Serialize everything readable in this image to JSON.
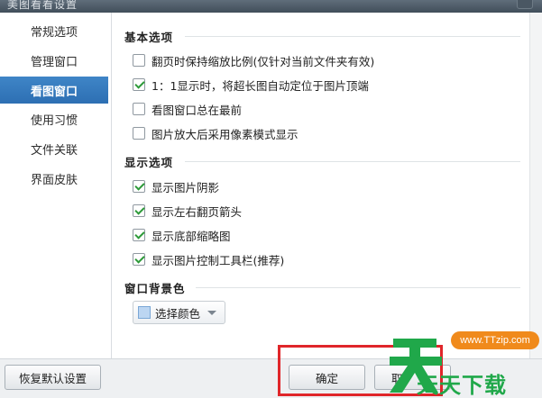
{
  "window": {
    "title": "美图看看设置"
  },
  "sidebar": {
    "items": [
      {
        "label": "常规选项",
        "active": false
      },
      {
        "label": "管理窗口",
        "active": false
      },
      {
        "label": "看图窗口",
        "active": true
      },
      {
        "label": "使用习惯",
        "active": false
      },
      {
        "label": "文件关联",
        "active": false
      },
      {
        "label": "界面皮肤",
        "active": false
      }
    ]
  },
  "main": {
    "basic": {
      "title": "基本选项",
      "options": [
        {
          "label": "翻页时保持缩放比例(仅针对当前文件夹有效)",
          "checked": false
        },
        {
          "label": "1：1显示时，将超长图自动定位于图片顶端",
          "checked": true
        },
        {
          "label": "看图窗口总在最前",
          "checked": false
        },
        {
          "label": "图片放大后采用像素模式显示",
          "checked": false
        }
      ]
    },
    "display": {
      "title": "显示选项",
      "options": [
        {
          "label": "显示图片阴影",
          "checked": true
        },
        {
          "label": "显示左右翻页箭头",
          "checked": true
        },
        {
          "label": "显示底部缩略图",
          "checked": true
        },
        {
          "label": "显示图片控制工具栏(推荐)",
          "checked": true
        }
      ]
    },
    "background": {
      "title": "窗口背景色",
      "button_label": "选择颜色",
      "swatch_color": "#bcd6f2"
    }
  },
  "footer": {
    "restore_label": "恢复默认设置",
    "ok_label": "确定",
    "cancel_label": "取"
  },
  "watermark": {
    "url": "www.TTzip.com",
    "text": "天天下载"
  },
  "colors": {
    "accent": "#2d6fb3",
    "check": "#2d9a39",
    "highlight_box": "#e0262a",
    "watermark_green": "#20a84a",
    "watermark_orange": "#f08a1c"
  }
}
